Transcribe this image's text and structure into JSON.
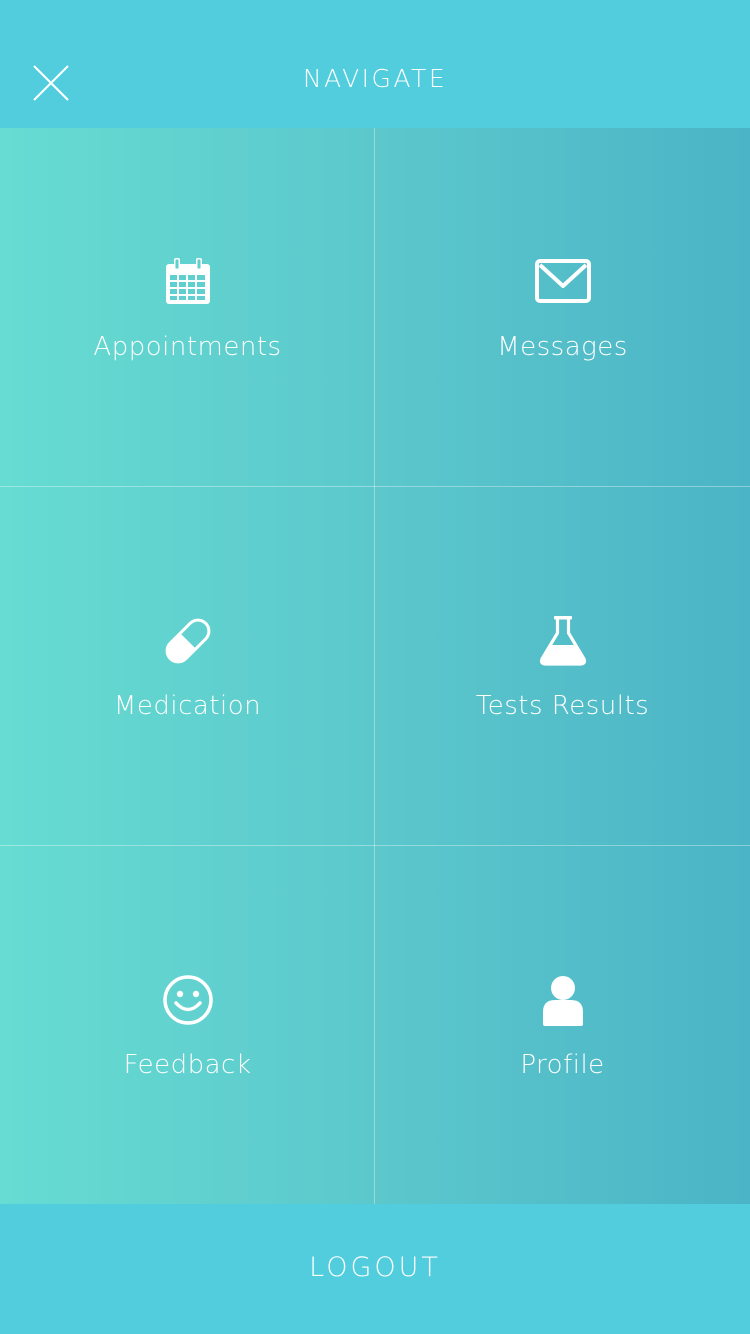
{
  "header": {
    "title": "NAVIGATE",
    "close_icon": "close-icon"
  },
  "menu": {
    "items": [
      {
        "label": "Appointments",
        "icon": "calendar-icon"
      },
      {
        "label": "Messages",
        "icon": "envelope-icon"
      },
      {
        "label": "Medication",
        "icon": "pill-icon"
      },
      {
        "label": "Tests Results",
        "icon": "flask-icon"
      },
      {
        "label": "Feedback",
        "icon": "smiley-icon"
      },
      {
        "label": "Profile",
        "icon": "user-icon"
      }
    ]
  },
  "footer": {
    "logout_label": "LOGOUT"
  },
  "colors": {
    "header_bg": "#51cdde",
    "gradient_left": "#66dcd2",
    "gradient_right": "#4bb4c6",
    "text": "#ffffff"
  }
}
